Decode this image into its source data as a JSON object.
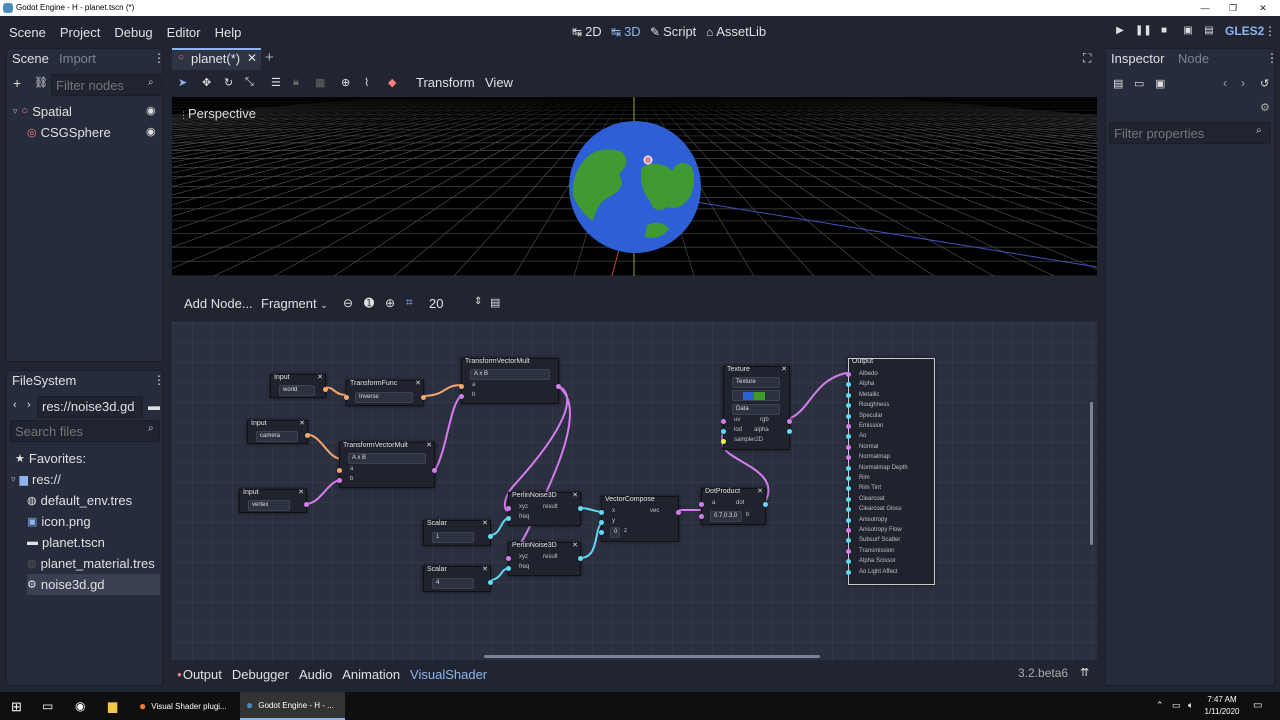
{
  "window": {
    "title": "Godot Engine - H - planet.tscn (*)",
    "controls": [
      "—",
      "❐",
      "✕"
    ]
  },
  "menu": {
    "items": [
      "Scene",
      "Project",
      "Debug",
      "Editor",
      "Help"
    ]
  },
  "workspaces": [
    {
      "label": "2D",
      "icon": "↹"
    },
    {
      "label": "3D",
      "icon": "↹"
    },
    {
      "label": "Script",
      "icon": "✎"
    },
    {
      "label": "AssetLib",
      "icon": "⌂"
    }
  ],
  "renderer": "GLES2",
  "scene_dock": {
    "tabs": [
      "Scene",
      "Import"
    ],
    "filter_placeholder": "Filter nodes",
    "nodes": [
      {
        "label": "Spatial",
        "icon": "○"
      },
      {
        "label": "CSGSphere",
        "icon": "◎"
      }
    ]
  },
  "filesystem": {
    "tab": "FileSystem",
    "path": "res://noise3d.gd",
    "search_placeholder": "Search files",
    "favorites": "Favorites:",
    "root": "res://",
    "files": [
      {
        "name": "default_env.tres",
        "icon": "◍"
      },
      {
        "name": "icon.png",
        "icon": "▣"
      },
      {
        "name": "planet.tscn",
        "icon": "▬"
      },
      {
        "name": "planet_material.tres",
        "icon": "◍"
      },
      {
        "name": "noise3d.gd",
        "icon": "⚙"
      }
    ]
  },
  "editor_tabs": {
    "open": "planet(*)",
    "add": "+"
  },
  "toolbar3d": {
    "transform": "Transform",
    "view": "View"
  },
  "viewport": {
    "label": "Perspective"
  },
  "shader_toolbar": {
    "add_node": "Add Node...",
    "mode": "Fragment",
    "zoom": "20"
  },
  "nodes": {
    "input1": {
      "title": "Input",
      "value": "world"
    },
    "input2": {
      "title": "Input",
      "value": "camera"
    },
    "input3": {
      "title": "Input",
      "value": "vertex"
    },
    "tfunc": {
      "title": "TransformFunc",
      "value": "Inverse"
    },
    "tvm1": {
      "title": "TransformVectorMult",
      "value": "A x B",
      "a": "a",
      "b": "b"
    },
    "tvm2": {
      "title": "TransformVectorMult",
      "value": "A x B",
      "a": "a",
      "b": "b"
    },
    "scalar1": {
      "title": "Scalar",
      "value": "1"
    },
    "scalar2": {
      "title": "Scalar",
      "value": "4"
    },
    "pn1": {
      "title": "PerlinNoise3D",
      "xyz": "xyz",
      "freq": "freq",
      "result": "result"
    },
    "pn2": {
      "title": "PerlinNoise3D",
      "xyz": "xyz",
      "freq": "freq",
      "result": "result"
    },
    "vc": {
      "title": "VectorCompose",
      "x": "x",
      "y": "y",
      "z": "z",
      "zval": "0",
      "vec": "vec"
    },
    "dot": {
      "title": "DotProduct",
      "a": "a",
      "dot": "dot",
      "b": "b",
      "aval": "0.7,0.3,0"
    },
    "texture": {
      "title": "Texture",
      "src": "Texture",
      "type": "Data",
      "uv": "uv",
      "lod": "lod",
      "rgb": "rgb",
      "alpha": "alpha",
      "sampler": "sampler2D"
    },
    "output": {
      "title": "Output",
      "ports": [
        "Albedo",
        "Alpha",
        "Metallic",
        "Roughness",
        "Specular",
        "Emission",
        "Ao",
        "Normal",
        "Normalmap",
        "Normalmap Depth",
        "Rim",
        "Rim Tint",
        "Clearcoat",
        "Clearcoat Gloss",
        "Anisotropy",
        "Anisotropy Flow",
        "Subsurf Scatter",
        "Transmission",
        "Alpha Scissor",
        "Ao Light Affect"
      ]
    }
  },
  "bottom": {
    "tabs": [
      "Output",
      "Debugger",
      "Audio",
      "Animation",
      "VisualShader"
    ],
    "version": "3.2.beta6"
  },
  "inspector": {
    "tabs": [
      "Inspector",
      "Node"
    ],
    "filter_placeholder": "Filter properties"
  },
  "taskbar": {
    "apps": [
      {
        "label": "Visual Shader plugi..."
      },
      {
        "label": "Godot Engine - H - ..."
      }
    ],
    "time": "7:47 AM",
    "date": "1/11/2020"
  },
  "colors": {
    "accent": "#8eb4f0",
    "port_vec": "#d67dee",
    "port_scalar": "#61daf4",
    "port_transform": "#f6a86e",
    "port_sampler": "#eeee59"
  }
}
